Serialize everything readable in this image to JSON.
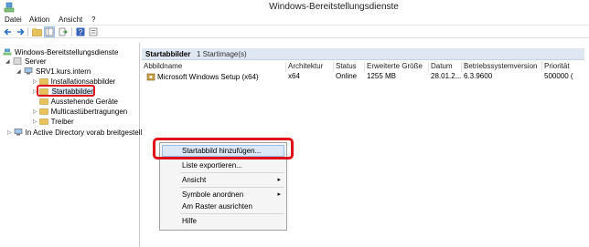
{
  "window": {
    "title": "Windows-Bereitstellungsdienste",
    "app_icon": "wds-icon"
  },
  "menubar": {
    "items": [
      "Datei",
      "Aktion",
      "Ansicht",
      "?"
    ]
  },
  "toolbar": {
    "icons": [
      "back-arrow-icon",
      "forward-arrow-icon",
      "up-folder-icon",
      "show-tree-icon",
      "export-list-icon",
      "help-icon",
      "properties-icon"
    ]
  },
  "tree": {
    "root": "Windows-Bereitstellungsdienste",
    "server": "Server",
    "host": "SRV1.kurs.intern",
    "children": [
      "Installationsabbilder",
      "Startabbilder",
      "Ausstehende Geräte",
      "Multicastübertragungen",
      "Treiber"
    ],
    "ad": "In Active Directory vorab breitgestellt"
  },
  "panel": {
    "title": "Startabbilder",
    "count": "1 Startimage(s)",
    "columns": [
      "Abbildname",
      "Architektur",
      "Status",
      "Erweiterte Größe",
      "Datum",
      "Betriebssystemversion",
      "Priorität"
    ],
    "rows": [
      {
        "name": "Microsoft Windows Setup (x64)",
        "arch": "x64",
        "status": "Online",
        "size": "1255 MB",
        "date": "28.01.2...",
        "os": "6.3.9600",
        "priority": "500000 ("
      }
    ]
  },
  "context_menu": {
    "items": [
      "Startabbild hinzufügen...",
      "Liste exportieren...",
      "Ansicht",
      "Symbole anordnen",
      "Am Raster ausrichten",
      "Hilfe"
    ]
  },
  "colors": {
    "highlight_red": "#e0101a",
    "header_blue": "#dfe7f2",
    "folder_yellow": "#e8c15a"
  }
}
